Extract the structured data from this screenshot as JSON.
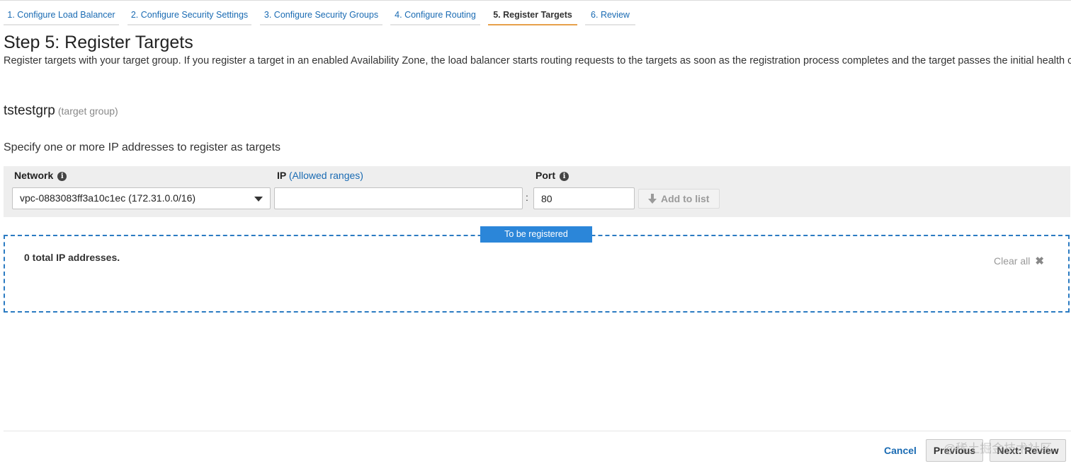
{
  "wizard": {
    "steps": [
      {
        "label": "1. Configure Load Balancer"
      },
      {
        "label": "2. Configure Security Settings"
      },
      {
        "label": "3. Configure Security Groups"
      },
      {
        "label": "4. Configure Routing"
      },
      {
        "label": "5. Register Targets"
      },
      {
        "label": "6. Review"
      }
    ],
    "active_index": 4
  },
  "page": {
    "title": "Step 5: Register Targets",
    "description": "Register targets with your target group. If you register a target in an enabled Availability Zone, the load balancer starts routing requests to the targets as soon as the registration process completes and the target passes the initial health checks."
  },
  "target_group": {
    "name": "tstestgrp",
    "suffix": "(target group)"
  },
  "form": {
    "heading": "Specify one or more IP addresses to register as targets",
    "network_label": "Network",
    "ip_label": "IP",
    "ip_link": "(Allowed ranges)",
    "port_label": "Port",
    "network_value": "vpc-0883083ff3a10c1ec (172.31.0.0/16)",
    "ip_value": "",
    "colon": ":",
    "port_value": "80",
    "add_button": "Add to list",
    "info_icon_glyph": "i"
  },
  "registered": {
    "badge": "To be registered",
    "total": "0 total IP addresses.",
    "clear_all": "Clear all",
    "clear_icon_glyph": "✖"
  },
  "footer": {
    "cancel": "Cancel",
    "previous": "Previous",
    "next": "Next: Review",
    "watermark": "@稀土掘金技术社区"
  },
  "colors": {
    "link": "#1a6bb3",
    "active_tab_underline": "#e7a14a",
    "badge": "#2b86d9",
    "dashed_border": "#2b7bc2"
  }
}
